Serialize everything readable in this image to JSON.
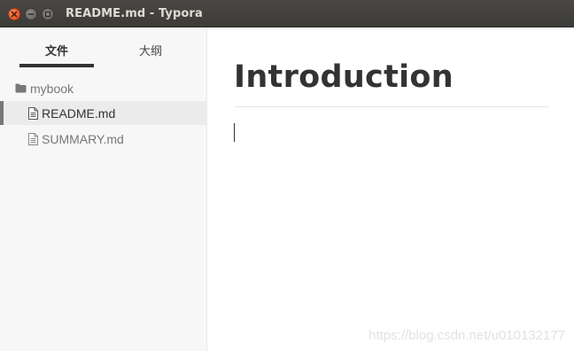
{
  "window": {
    "title": "README.md - Typora"
  },
  "sidebar": {
    "tabs": [
      {
        "label": "文件",
        "active": true
      },
      {
        "label": "大纲",
        "active": false
      }
    ],
    "tree": {
      "folder": {
        "label": "mybook",
        "icon": "folder-icon"
      },
      "files": [
        {
          "label": "README.md",
          "icon": "file-icon",
          "active": true
        },
        {
          "label": "SUMMARY.md",
          "icon": "file-icon",
          "active": false
        }
      ]
    }
  },
  "editor": {
    "heading": "Introduction",
    "watermark": "https://blog.csdn.net/u010132177"
  },
  "colors": {
    "titlebar": "#3c3b37",
    "close_button": "#df4a16",
    "sidebar_bg": "#f7f7f7",
    "active_row_bg": "#ebebeb",
    "text": "#333333"
  }
}
